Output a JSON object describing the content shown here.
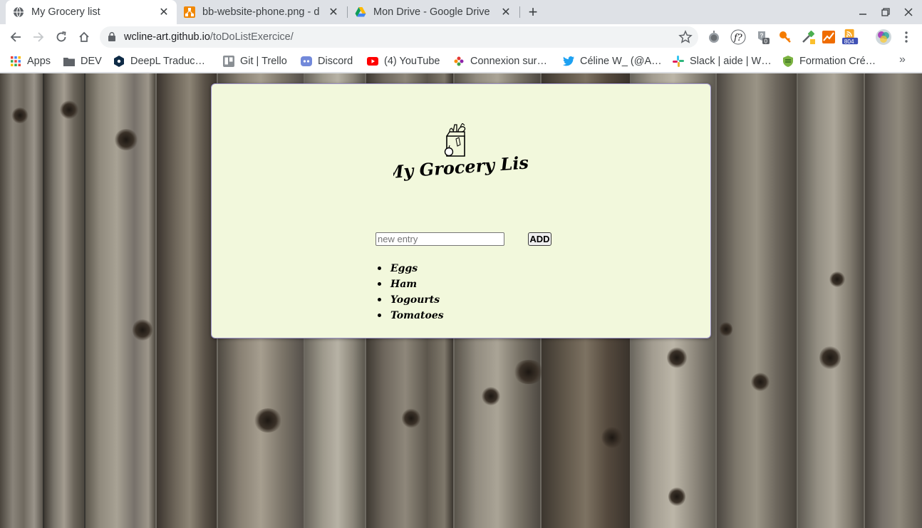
{
  "browser": {
    "tabs": [
      {
        "title": "My Grocery list",
        "favicon": "globe-icon",
        "active": true
      },
      {
        "title": "bb-website-phone.png - d",
        "favicon": "drawio-icon",
        "active": false
      },
      {
        "title": "Mon Drive - Google Drive",
        "favicon": "google-drive-icon",
        "active": false
      }
    ],
    "url_host": "wcline-art.github.io",
    "url_path": "/toDoListExercice/",
    "extension_badge": "804",
    "extension_counter": "0"
  },
  "bookmarks": [
    {
      "label": "Apps",
      "icon": "apps-grid-icon"
    },
    {
      "label": "DEV",
      "icon": "folder-icon"
    },
    {
      "label": "DeepL Traduc…",
      "icon": "deepl-icon"
    },
    {
      "label": "Git | Trello",
      "icon": "trello-icon"
    },
    {
      "label": "Discord",
      "icon": "discord-icon"
    },
    {
      "label": "(4) YouTube",
      "icon": "youtube-icon"
    },
    {
      "label": "Connexion sur…",
      "icon": "pinwheel-icon"
    },
    {
      "label": "Céline W_ (@A…",
      "icon": "twitter-icon"
    },
    {
      "label": "Slack | aide | W…",
      "icon": "slack-icon"
    },
    {
      "label": "Formation Cré…",
      "icon": "shield-icon"
    }
  ],
  "app": {
    "logo_text": "My Grocery List",
    "input_placeholder": "new entry",
    "add_label": "ADD",
    "items": [
      "Eggs",
      "Ham",
      "Yogourts",
      "Tomatoes"
    ]
  },
  "colors": {
    "card_bg": "#f2f8dc",
    "card_border": "#9c93c9",
    "tabstrip_bg": "#dee1e6"
  }
}
